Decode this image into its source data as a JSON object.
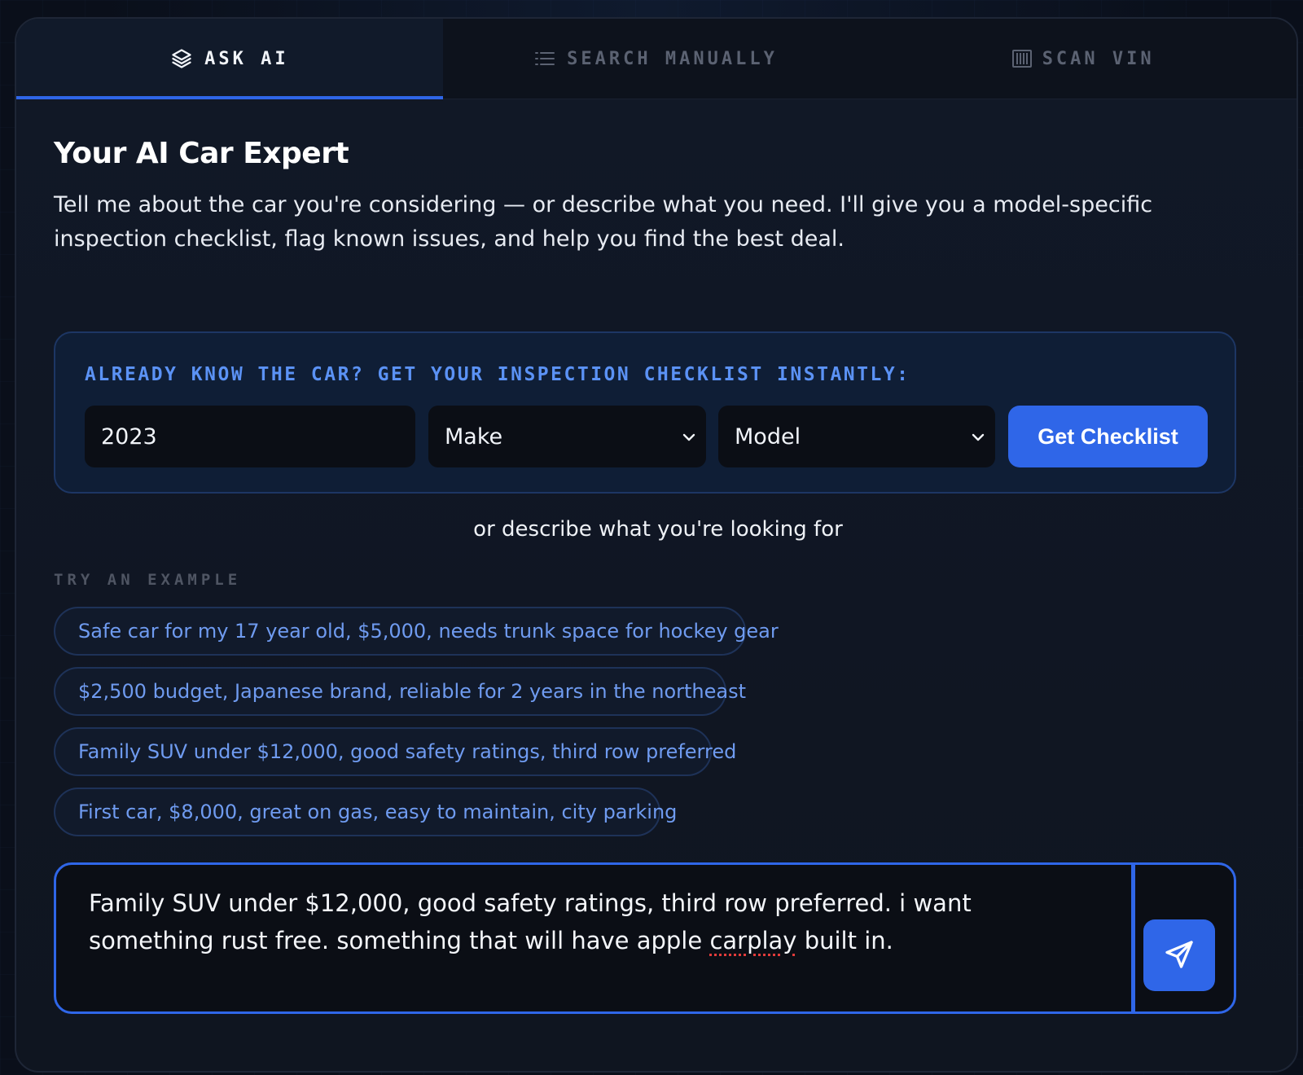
{
  "tabs": [
    {
      "label": "ASK AI",
      "icon": "layers-icon",
      "active": true
    },
    {
      "label": "SEARCH MANUALLY",
      "icon": "list-icon",
      "active": false
    },
    {
      "label": "SCAN VIN",
      "icon": "barcode-icon",
      "active": false
    }
  ],
  "hero": {
    "title": "Your AI Car Expert",
    "description": "Tell me about the car you're considering — or describe what you need. I'll give you a model-specific inspection checklist, flag known issues, and help you find the best deal."
  },
  "quick_checklist": {
    "title": "ALREADY KNOW THE CAR? GET YOUR INSPECTION CHECKLIST INSTANTLY:",
    "year_value": "2023",
    "make_value": "Make",
    "model_value": "Model",
    "button_label": "Get Checklist"
  },
  "divider_text": "or describe what you're looking for",
  "examples": {
    "label": "TRY AN EXAMPLE",
    "items": [
      "Safe car for my 17 year old, $5,000, needs trunk space for hockey gear",
      "$2,500 budget, Japanese brand, reliable for 2 years in the northeast",
      "Family SUV under $12,000, good safety ratings, third row preferred",
      "First car, $8,000, great on gas, easy to maintain, city parking"
    ]
  },
  "composer": {
    "text_before": "Family SUV under $12,000, good safety ratings, third row preferred. i want something rust free. something that will have apple ",
    "misspelled_word": "carplay",
    "text_after": " built in.",
    "send_icon": "send-icon"
  },
  "colors": {
    "accent": "#2f66e8",
    "chip_text": "#6f9bf0",
    "section_title": "#5b92f5",
    "background": "#0a0f1a"
  }
}
